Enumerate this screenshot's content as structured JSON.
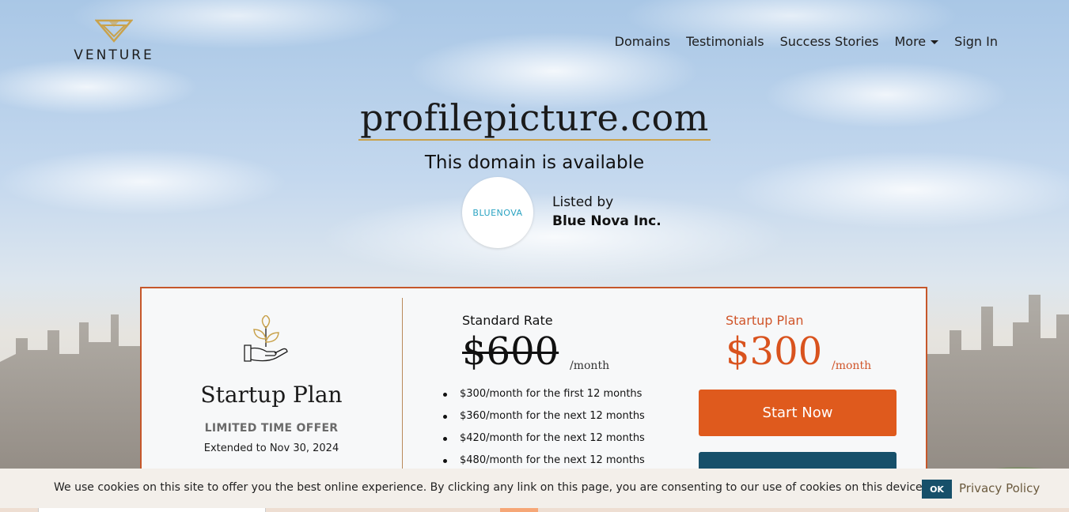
{
  "brand": {
    "name": "VENTURE",
    "accent": "#c9a24c"
  },
  "nav": {
    "items": [
      "Domains",
      "Testimonials",
      "Success Stories",
      "More",
      "Sign In"
    ]
  },
  "hero": {
    "domain": "profilepicture.com",
    "subtitle": "This domain is available",
    "seller_logo_text": "BLUENOVA",
    "listed_by_label": "Listed by",
    "seller_name": "Blue Nova Inc."
  },
  "pricing": {
    "plan_icon": "hand-plant-icon",
    "plan_title": "Startup Plan",
    "offer_label": "LIMITED TIME OFFER",
    "offer_extended": "Extended to Nov 30, 2024",
    "standard": {
      "label": "Standard Rate",
      "price": "$600",
      "unit": "/month"
    },
    "schedule": [
      "$300/month for the first 12 months",
      "$360/month for the next 12 months",
      "$420/month for the next 12 months",
      "$480/month for the next 12 months"
    ],
    "startup": {
      "label": "Startup Plan",
      "price": "$300",
      "unit": "/month"
    },
    "cta_label": "Start Now",
    "colors": {
      "orange": "#df5a1d",
      "navy": "#17506a",
      "border": "#c6572a"
    }
  },
  "cookie": {
    "text": "We use cookies on this site to offer you the best online experience. By clicking any link on this page, you are consenting to our use of cookies on this device.",
    "ok_label": "OK",
    "policy_label": "Privacy Policy"
  }
}
